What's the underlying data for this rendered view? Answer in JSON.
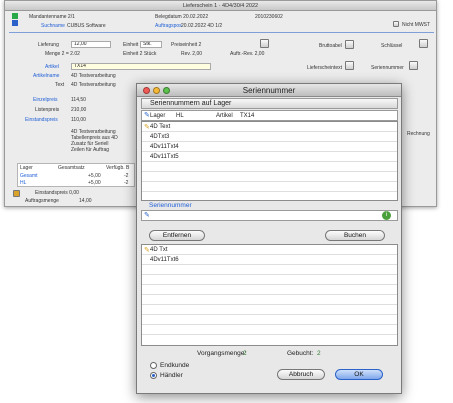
{
  "bg_window": {
    "title": "Lieferschein 1 · 4D4/30/4 2022",
    "top_fields": {
      "mandant_label": "Mandantenname 2/1",
      "date_label": "Belegdatum 20.02.2022",
      "number_value": "2010230602",
      "suchname_label": "Suchname",
      "suchname_value": "CUBUS Software",
      "auftragspos_label": "Auftragspos",
      "auftragspos_value": "20.02.2022 4D 1/2",
      "nicht_mwst_label": "Nicht MWST"
    },
    "lieferung_label": "Lieferung",
    "lieferung_value": "12,00",
    "einheit_label": "Einheit",
    "einheit_value": "Stk.",
    "preiseinheit_label": "Preiseinheit 2",
    "menge_label": "Menge 2 = 2.02",
    "einheit2_label": "Einheit 2 Stück",
    "rev_label": "Rev. 2,00",
    "auftr_label": "Auftr.-Rev. 2,00",
    "artikel_label": "Artikel",
    "artikel_value": "TX14",
    "artikelname_label": "Artikelname",
    "artikelname_value": "4D Testverarbeitung",
    "text_label": "Text",
    "text_value": "4D Testverarbeitung",
    "einzelpreis_label": "Einzelpreis",
    "einzelpreis_value": "114,50",
    "listenpreis_label": "Listenpreis",
    "listenpreis_value": "210,00",
    "einstandspreis_label": "Einstandspreis",
    "einstandspreis_value": "110,00",
    "description_lines": [
      "4D Testverarbeitung",
      "Tabellenpreis aus 4D",
      "Zusatz für Seriell",
      "Zeilen für Auftrag"
    ],
    "rechnung_label": "Rechnung",
    "seriennummer_btn_label": "Seriennummer",
    "lager_header": [
      "Lager",
      "Gesamtsatz",
      "Verfügb. B"
    ],
    "lager_rows": [
      {
        "name": "Gesamt",
        "qty": "+5,00",
        "avail": "-2"
      },
      {
        "name": "HL",
        "qty": "+5,00",
        "avail": "-2"
      }
    ],
    "einstandspreis2_label": "Einstandspreis 0,00",
    "auftragsmenge_label": "Auftragsmenge",
    "auftragsmenge_value": "14,00"
  },
  "dialog": {
    "title": "Seriennummer",
    "stock_section_title": "Seriennummern auf Lager",
    "lager_label": "Lager",
    "lager_value": "HL",
    "artikel_label": "Artikel",
    "artikel_value": "TX14",
    "stock_items": [
      "4D Text",
      "4DTxt3",
      "4Dv11Txt4",
      "4Dv11Txt5"
    ],
    "serial_section_title": "Seriennummer",
    "entfernen_label": "Entfernen",
    "buchen_label": "Buchen",
    "booked_items": [
      "4D Txt",
      "4Dv11Txt6"
    ],
    "vorgangsmenge_label": "Vorgangsmenge:",
    "vorgangsmenge_value": "2",
    "gebucht_label": "Gebucht:",
    "gebucht_value": "2",
    "radio_options": [
      {
        "label": "Endkunde",
        "selected": false
      },
      {
        "label": "Händler",
        "selected": true
      }
    ],
    "abbruch_label": "Abbruch",
    "ok_label": "OK"
  },
  "colors": {
    "accent_blue": "#2a62c9",
    "link_blue": "#1f5fd6",
    "status_green": "#28a846"
  }
}
